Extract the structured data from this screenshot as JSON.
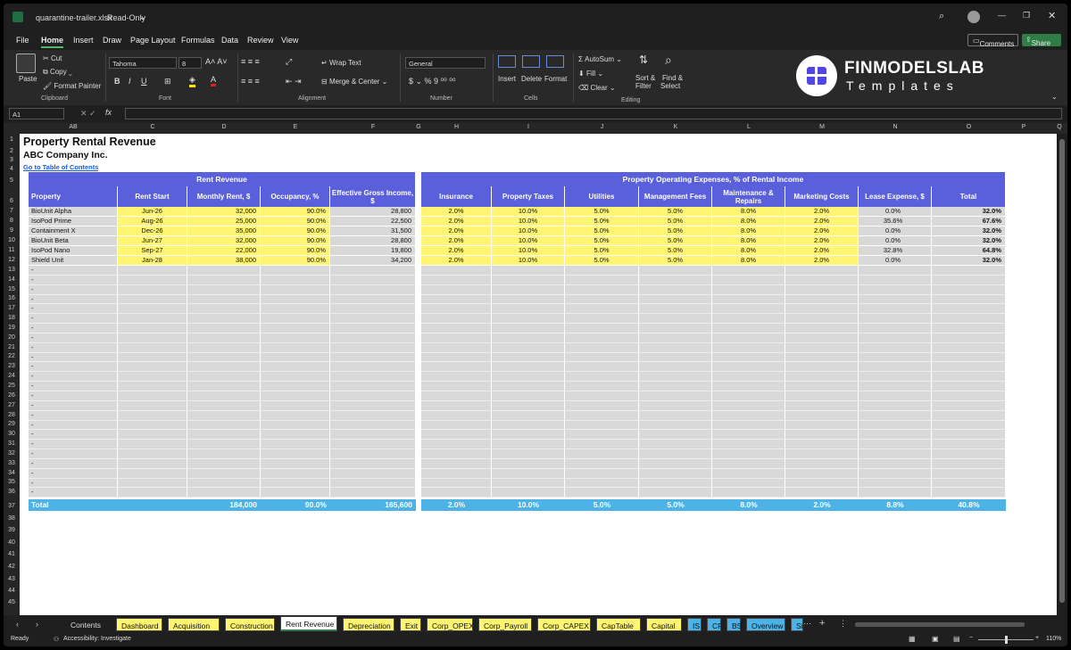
{
  "window": {
    "filename": "quarantine-trailer.xlsx",
    "mode": "Read-Only"
  },
  "menu": [
    "File",
    "Home",
    "Insert",
    "Draw",
    "Page Layout",
    "Formulas",
    "Data",
    "Review",
    "View"
  ],
  "actions": {
    "comments": "Comments",
    "share": "Share"
  },
  "ribbon": {
    "paste": "Paste",
    "cut": "Cut",
    "copy": "Copy",
    "format_painter": "Format Painter",
    "clipboard": "Clipboard",
    "font_name": "Tahoma",
    "font_size": "8",
    "font": "Font",
    "wrap": "Wrap Text",
    "merge": "Merge & Center",
    "alignment": "Alignment",
    "number_format": "General",
    "number": "Number",
    "insert": "Insert",
    "delete": "Delete",
    "format": "Format",
    "cells": "Cells",
    "autosum": "AutoSum",
    "fill": "Fill",
    "clear": "Clear",
    "sort": "Sort &",
    "filter": "Filter",
    "find": "Find &",
    "select": "Select",
    "editing": "Editing",
    "logo_title": "FINMODELSLAB",
    "logo_sub": "Templates"
  },
  "formula_bar": {
    "cell_ref": "A1",
    "fx": "fx"
  },
  "columns": [
    "AB",
    "C",
    "D",
    "E",
    "F",
    "G",
    "H",
    "I",
    "J",
    "K",
    "L",
    "M",
    "N",
    "O",
    "P",
    "Q"
  ],
  "sheet": {
    "title": "Property Rental Revenue",
    "company": "ABC Company Inc.",
    "link": "Go to Table of Contents",
    "rent_header": "Rent Revenue",
    "opex_header": "Property Operating Expenses, % of Rental Income",
    "col_headers": [
      "Property",
      "Rent Start",
      "Monthly Rent, $",
      "Occupancy, %",
      "Effective Gross Income, $",
      "Insurance",
      "Property Taxes",
      "Utilities",
      "Management Fees",
      "Maintenance & Repairs",
      "Marketing Costs",
      "Lease Expense, $",
      "Total"
    ],
    "rows": [
      [
        "BioUnit Alpha",
        "Jun-26",
        "32,000",
        "90.0%",
        "28,800",
        "2.0%",
        "10.0%",
        "5.0%",
        "5.0%",
        "8.0%",
        "2.0%",
        "0.0%",
        "32.0%"
      ],
      [
        "IsoPod Prime",
        "Aug-26",
        "25,000",
        "90.0%",
        "22,500",
        "2.0%",
        "10.0%",
        "5.0%",
        "5.0%",
        "8.0%",
        "2.0%",
        "35.6%",
        "67.6%"
      ],
      [
        "Containment X",
        "Dec-26",
        "35,000",
        "90.0%",
        "31,500",
        "2.0%",
        "10.0%",
        "5.0%",
        "5.0%",
        "8.0%",
        "2.0%",
        "0.0%",
        "32.0%"
      ],
      [
        "BioUnit Beta",
        "Jun-27",
        "32,000",
        "90.0%",
        "28,800",
        "2.0%",
        "10.0%",
        "5.0%",
        "5.0%",
        "8.0%",
        "2.0%",
        "0.0%",
        "32.0%"
      ],
      [
        "IsoPod Nano",
        "Sep-27",
        "22,000",
        "90.0%",
        "19,800",
        "2.0%",
        "10.0%",
        "5.0%",
        "5.0%",
        "8.0%",
        "2.0%",
        "32.8%",
        "64.8%"
      ],
      [
        "Shield Unit",
        "Jan-28",
        "38,000",
        "90.0%",
        "34,200",
        "2.0%",
        "10.0%",
        "5.0%",
        "5.0%",
        "8.0%",
        "2.0%",
        "0.0%",
        "32.0%"
      ]
    ],
    "empty_marker": "-",
    "total": [
      "Total",
      "",
      "184,000",
      "90.0%",
      "165,600",
      "2.0%",
      "10.0%",
      "5.0%",
      "5.0%",
      "8.0%",
      "2.0%",
      "8.8%",
      "40.8%"
    ]
  },
  "row_numbers": [
    "1",
    "2",
    "3",
    "4",
    "5",
    "6",
    "7",
    "8",
    "9",
    "10",
    "11",
    "12",
    "13",
    "14",
    "15",
    "16",
    "17",
    "18",
    "19",
    "20",
    "21",
    "22",
    "23",
    "24",
    "25",
    "26",
    "27",
    "28",
    "29",
    "30",
    "31",
    "32",
    "33",
    "34",
    "35",
    "36",
    "37",
    "38",
    "39",
    "40",
    "41",
    "42",
    "43",
    "44",
    "45"
  ],
  "tabs": [
    {
      "label": "Contents",
      "color": "#1f1f1f"
    },
    {
      "label": "Dashboard",
      "color": "#fff573"
    },
    {
      "label": "Acquisition",
      "color": "#fff573"
    },
    {
      "label": "Construction",
      "color": "#fff573"
    },
    {
      "label": "Rent Revenue",
      "color": "#ffffff",
      "active": true
    },
    {
      "label": "Depreciation",
      "color": "#fff573"
    },
    {
      "label": "Exit",
      "color": "#fff573"
    },
    {
      "label": "Corp_OPEX",
      "color": "#fff573"
    },
    {
      "label": "Corp_Payroll",
      "color": "#fff573"
    },
    {
      "label": "Corp_CAPEX",
      "color": "#fff573"
    },
    {
      "label": "CapTable",
      "color": "#fff573"
    },
    {
      "label": "Capital",
      "color": "#fff573"
    },
    {
      "label": "IS",
      "color": "#4db3e6"
    },
    {
      "label": "CF",
      "color": "#4db3e6"
    },
    {
      "label": "BS",
      "color": "#4db3e6"
    },
    {
      "label": "Overview",
      "color": "#4db3e6"
    },
    {
      "label": "Si",
      "color": "#4db3e6"
    }
  ],
  "status": {
    "ready": "Ready",
    "accessibility": "Accessibility: Investigate",
    "zoom": "110%"
  }
}
